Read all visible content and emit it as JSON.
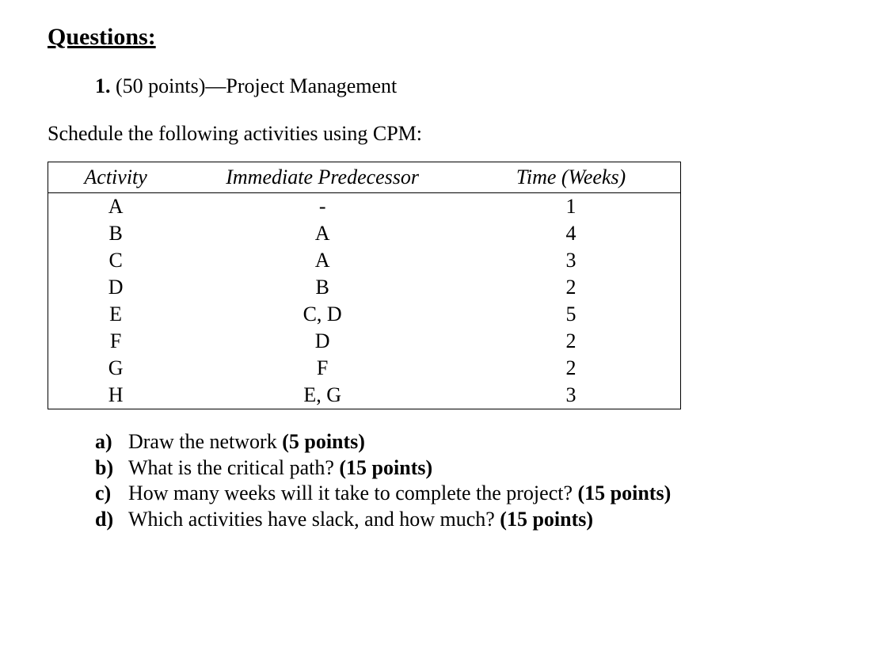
{
  "heading": "Questions:",
  "question": {
    "number": "1.",
    "points_prefix": "(50 points)",
    "dash": "—",
    "title": "Project Management"
  },
  "instruction": "Schedule the following activities using CPM:",
  "table": {
    "headers": {
      "activity": "Activity",
      "predecessor": "Immediate Predecessor",
      "time": "Time (Weeks)"
    },
    "rows": [
      {
        "activity": "A",
        "predecessor": "-",
        "time": "1"
      },
      {
        "activity": "B",
        "predecessor": "A",
        "time": "4"
      },
      {
        "activity": "C",
        "predecessor": "A",
        "time": "3"
      },
      {
        "activity": "D",
        "predecessor": "B",
        "time": "2"
      },
      {
        "activity": "E",
        "predecessor": "C, D",
        "time": "5"
      },
      {
        "activity": "F",
        "predecessor": "D",
        "time": "2"
      },
      {
        "activity": "G",
        "predecessor": "F",
        "time": "2"
      },
      {
        "activity": "H",
        "predecessor": "E, G",
        "time": "3"
      }
    ]
  },
  "subquestions": [
    {
      "letter": "a)",
      "text": "Draw the network ",
      "pts": "(5 points)"
    },
    {
      "letter": "b)",
      "text": "What is the critical path? ",
      "pts": "(15 points)"
    },
    {
      "letter": "c)",
      "text": "How many weeks will it take to complete the project? ",
      "pts": "(15 points)"
    },
    {
      "letter": "d)",
      "text": "Which activities have slack, and how much? ",
      "pts": "(15 points)"
    }
  ]
}
